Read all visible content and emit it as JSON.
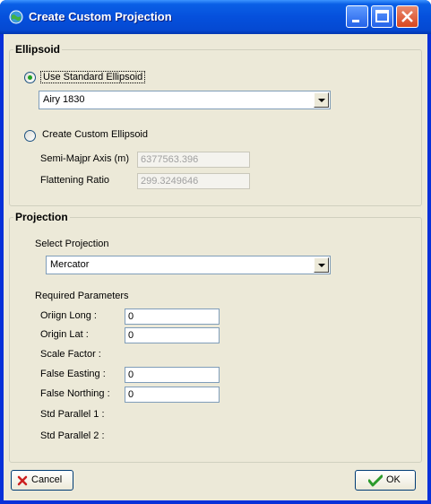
{
  "window": {
    "title": "Create Custom Projection"
  },
  "ellipsoid": {
    "group_title": "Ellipsoid",
    "use_standard_label": "Use Standard Ellipsoid",
    "use_standard_checked": true,
    "standard_selected": "Airy 1830",
    "create_custom_label": "Create Custom Ellipsoid",
    "create_custom_checked": false,
    "semi_major_label": "Semi-Majpr Axis (m)",
    "semi_major_value": "6377563.396",
    "flattening_label": "Flattening Ratio",
    "flattening_value": "299.3249646"
  },
  "projection": {
    "group_title": "Projection",
    "select_label": "Select Projection",
    "selected": "Mercator",
    "required_params_label": "Required Parameters",
    "params": {
      "origin_long_label": "Oriign Long :",
      "origin_long_value": "0",
      "origin_lat_label": "Origin Lat :",
      "origin_lat_value": "0",
      "scale_factor_label": "Scale Factor :",
      "false_easting_label": "False Easting :",
      "false_easting_value": "0",
      "false_northing_label": "False Northing :",
      "false_northing_value": "0",
      "std_parallel_1_label": "Std Parallel 1 :",
      "std_parallel_2_label": "Std Parallel 2 :"
    }
  },
  "buttons": {
    "cancel_label": "Cancel",
    "ok_label": "OK"
  },
  "colors": {
    "titlebar": "#0550dc",
    "client": "#ece9d8",
    "close_button": "#d9461f",
    "cancel_icon": "#cc2020",
    "ok_icon": "#2a9a2a"
  }
}
